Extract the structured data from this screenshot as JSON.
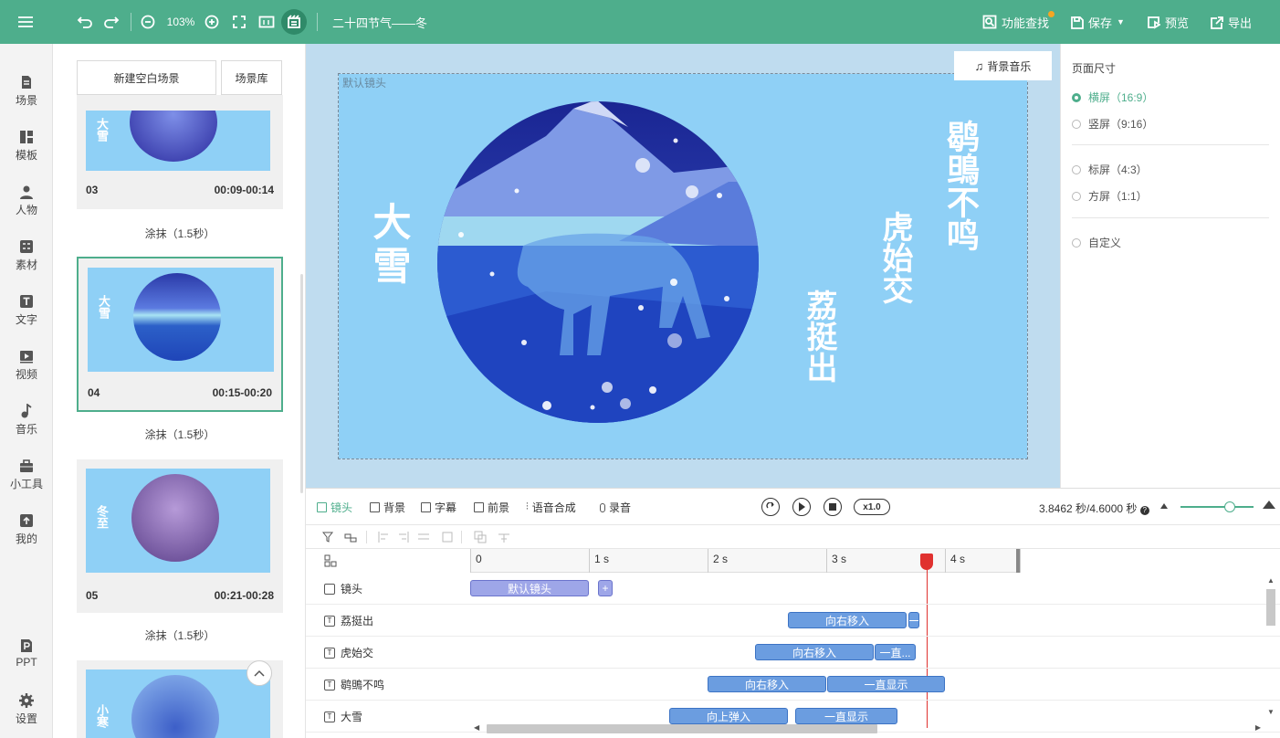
{
  "toolbar": {
    "zoom": "103%",
    "doc_title": "二十四节气——冬",
    "feature_search": "功能查找",
    "save": "保存",
    "preview": "预览",
    "export": "导出"
  },
  "nav": {
    "items": [
      {
        "label": "场景"
      },
      {
        "label": "模板"
      },
      {
        "label": "人物"
      },
      {
        "label": "素材"
      },
      {
        "label": "文字"
      },
      {
        "label": "视频"
      },
      {
        "label": "音乐"
      },
      {
        "label": "小工具"
      },
      {
        "label": "我的"
      },
      {
        "label": "PPT"
      },
      {
        "label": "设置"
      }
    ]
  },
  "scenes": {
    "new_blank": "新建空白场景",
    "library": "场景库",
    "cards": [
      {
        "num": "03",
        "time": "00:09-00:14",
        "title": "大雪",
        "transition": "涂抹（1.5秒）"
      },
      {
        "num": "04",
        "time": "00:15-00:20",
        "title": "大雪",
        "transition": "涂抹（1.5秒）"
      },
      {
        "num": "05",
        "time": "00:21-00:28",
        "title": "冬至",
        "transition": "涂抹（1.5秒）"
      },
      {
        "title": "小寒"
      }
    ]
  },
  "canvas": {
    "lens_label": "默认镜头",
    "bgm": "背景音乐",
    "title": "大雪",
    "poems": [
      "鹖鴠不鸣",
      "虎始交",
      "荔挺出"
    ]
  },
  "page_size": {
    "title": "页面尺寸",
    "options": [
      {
        "label": "横屏（16:9）",
        "selected": true
      },
      {
        "label": "竖屏（9:16）",
        "selected": false
      },
      {
        "label": "标屏（4:3）",
        "selected": false
      },
      {
        "label": "方屏（1:1）",
        "selected": false
      },
      {
        "label": "自定义",
        "selected": false
      }
    ]
  },
  "timeline": {
    "tabs": [
      "镜头",
      "背景",
      "字幕",
      "前景",
      "语音合成",
      "录音"
    ],
    "speed": "x1.0",
    "time": "3.8462 秒/4.6000 秒",
    "ruler": [
      "0",
      "1 s",
      "2 s",
      "3 s",
      "4 s"
    ],
    "tracks": [
      {
        "name": "镜头",
        "blocks": [
          {
            "label": "默认镜头",
            "start": 0.0,
            "end": 1.0
          },
          {
            "label": "+",
            "start": 1.08,
            "end": 1.2
          }
        ]
      },
      {
        "name": "荔挺出",
        "blocks": [
          {
            "label": "向右移入",
            "start": 2.68,
            "end": 3.68
          },
          {
            "label": "一",
            "start": 3.69,
            "end": 3.78
          }
        ]
      },
      {
        "name": "虎始交",
        "blocks": [
          {
            "label": "向右移入",
            "start": 2.4,
            "end": 3.4
          },
          {
            "label": "一直...",
            "start": 3.41,
            "end": 3.76
          }
        ]
      },
      {
        "name": "鹖鴠不鸣",
        "blocks": [
          {
            "label": "向右移入",
            "start": 2.0,
            "end": 3.0
          },
          {
            "label": "一直显示",
            "start": 3.01,
            "end": 4.0
          }
        ]
      },
      {
        "name": "大雪",
        "blocks": [
          {
            "label": "向上弹入",
            "start": 1.68,
            "end": 2.68
          },
          {
            "label": "一直显示",
            "start": 2.74,
            "end": 3.6
          }
        ]
      }
    ]
  }
}
